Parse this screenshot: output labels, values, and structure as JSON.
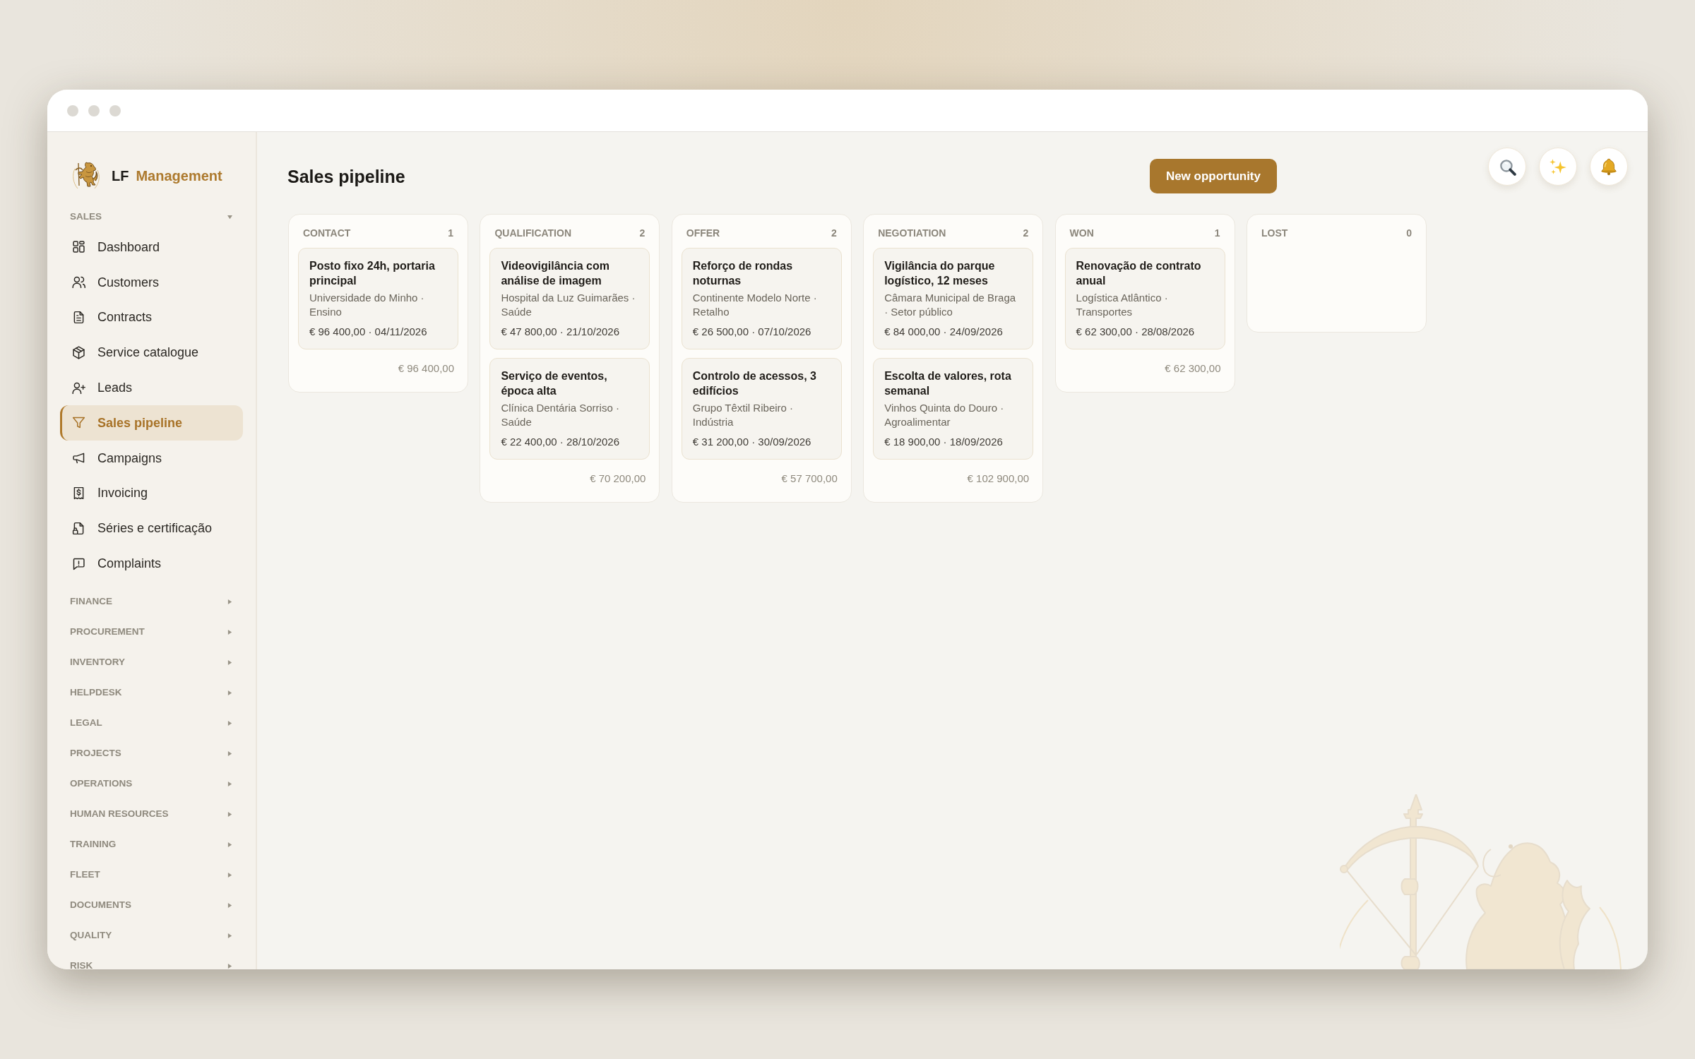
{
  "app": {
    "brand": {
      "prefix": "LF",
      "name": "Management"
    }
  },
  "sidebar": {
    "sections": [
      {
        "label": "SALES",
        "expanded": true,
        "items": [
          {
            "label": "Dashboard",
            "selected": false
          },
          {
            "label": "Customers",
            "selected": false
          },
          {
            "label": "Contracts",
            "selected": false
          },
          {
            "label": "Service catalogue",
            "selected": false
          },
          {
            "label": "Leads",
            "selected": false
          },
          {
            "label": "Sales pipeline",
            "selected": true
          },
          {
            "label": "Campaigns",
            "selected": false
          },
          {
            "label": "Invoicing",
            "selected": false
          },
          {
            "label": "Séries e certificação",
            "selected": false
          },
          {
            "label": "Complaints",
            "selected": false
          }
        ]
      },
      {
        "label": "FINANCE",
        "expanded": false
      },
      {
        "label": "PROCUREMENT",
        "expanded": false
      },
      {
        "label": "INVENTORY",
        "expanded": false
      },
      {
        "label": "HELPDESK",
        "expanded": false
      },
      {
        "label": "LEGAL",
        "expanded": false
      },
      {
        "label": "PROJECTS",
        "expanded": false
      },
      {
        "label": "OPERATIONS",
        "expanded": false
      },
      {
        "label": "HUMAN RESOURCES",
        "expanded": false
      },
      {
        "label": "TRAINING",
        "expanded": false
      },
      {
        "label": "FLEET",
        "expanded": false
      },
      {
        "label": "DOCUMENTS",
        "expanded": false
      },
      {
        "label": "QUALITY",
        "expanded": false
      },
      {
        "label": "RISK",
        "expanded": false
      }
    ]
  },
  "page": {
    "title": "Sales pipeline",
    "primary_button": "New opportunity"
  },
  "pipeline": {
    "columns": [
      {
        "title": "CONTACT",
        "count": "1",
        "cards": [
          {
            "title": "Posto fixo 24h, portaria principal",
            "company": "Universidade do Minho · Ensino",
            "amount_date": "€ 96 400,00 · 04/11/2026"
          }
        ],
        "total": "€ 96 400,00"
      },
      {
        "title": "QUALIFICATION",
        "count": "2",
        "cards": [
          {
            "title": "Videovigilância com análise de imagem",
            "company": "Hospital da Luz Guimarães · Saúde",
            "amount_date": "€ 47 800,00 · 21/10/2026"
          },
          {
            "title": "Serviço de eventos, época alta",
            "company": "Clínica Dentária Sorriso · Saúde",
            "amount_date": "€ 22 400,00 · 28/10/2026"
          }
        ],
        "total": "€ 70 200,00"
      },
      {
        "title": "OFFER",
        "count": "2",
        "cards": [
          {
            "title": "Reforço de rondas noturnas",
            "company": "Continente Modelo Norte · Retalho",
            "amount_date": "€ 26 500,00 · 07/10/2026"
          },
          {
            "title": "Controlo de acessos, 3 edifícios",
            "company": "Grupo Têxtil Ribeiro · Indústria",
            "amount_date": "€ 31 200,00 · 30/09/2026"
          }
        ],
        "total": "€ 57 700,00"
      },
      {
        "title": "NEGOTIATION",
        "count": "2",
        "cards": [
          {
            "title": "Vigilância do parque logístico, 12 meses",
            "company": "Câmara Municipal de Braga · Setor público",
            "amount_date": "€ 84 000,00 · 24/09/2026"
          },
          {
            "title": "Escolta de valores, rota semanal",
            "company": "Vinhos Quinta do Douro · Agroalimentar",
            "amount_date": "€ 18 900,00 · 18/09/2026"
          }
        ],
        "total": "€ 102 900,00"
      },
      {
        "title": "WON",
        "count": "1",
        "cards": [
          {
            "title": "Renovação de contrato anual",
            "company": "Logística Atlântico · Transportes",
            "amount_date": "€ 62 300,00 · 28/08/2026"
          }
        ],
        "total": "€ 62 300,00"
      },
      {
        "title": "LOST",
        "count": "0"
      }
    ]
  }
}
